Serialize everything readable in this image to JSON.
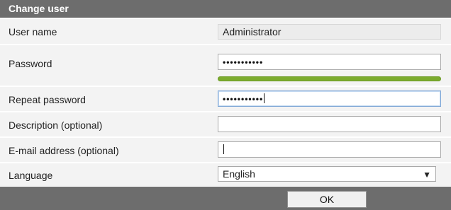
{
  "dialog": {
    "title": "Change user"
  },
  "form": {
    "username": {
      "label": "User name",
      "value": "Administrator"
    },
    "password": {
      "label": "Password",
      "value": "•••••••••••",
      "strength": 1.0
    },
    "repeat_password": {
      "label": "Repeat password",
      "value": "•••••••••••"
    },
    "description": {
      "label": "Description (optional)",
      "value": ""
    },
    "email": {
      "label": "E-mail address (optional)",
      "value": ""
    },
    "language": {
      "label": "Language",
      "selected": "English"
    }
  },
  "actions": {
    "ok_label": "OK"
  },
  "colors": {
    "header": "#6d6d6d",
    "row_bg": "#f3f3f3",
    "strength": "#7bab2e",
    "focus": "#7fa7d6"
  }
}
